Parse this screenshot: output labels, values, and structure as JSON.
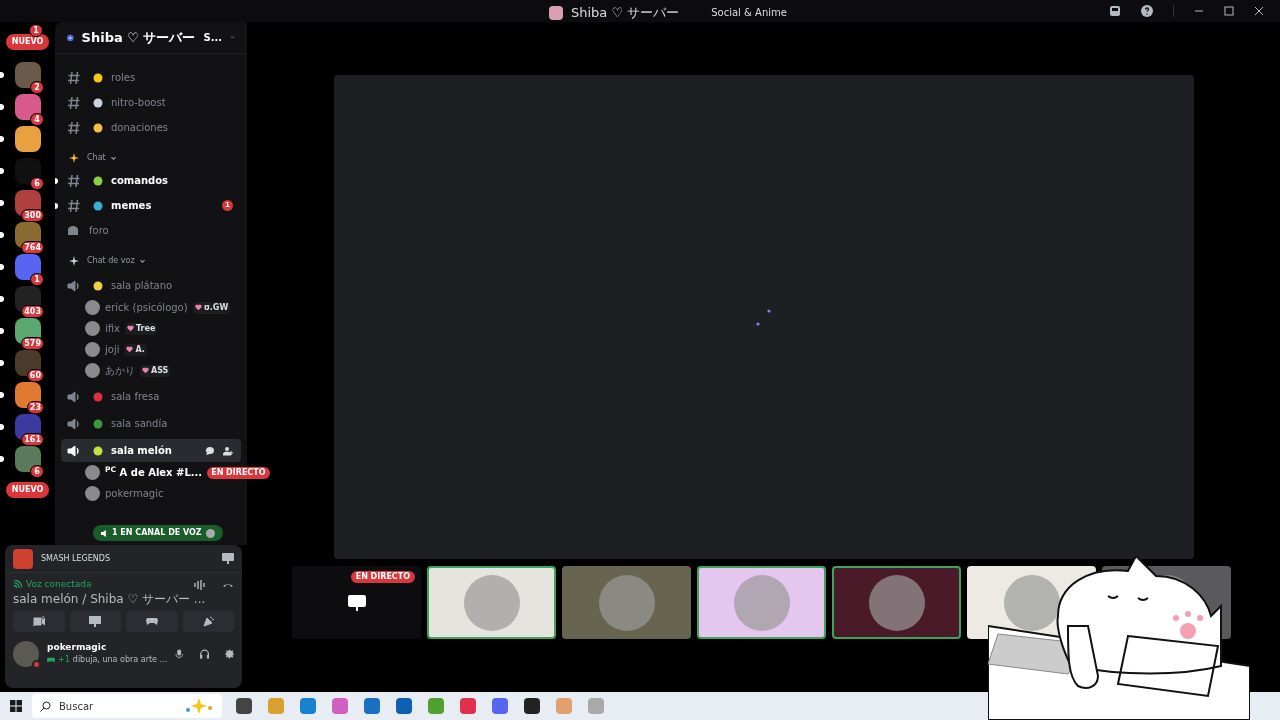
{
  "titlebar": {
    "server": "Shiba ♡ サーバー",
    "category": "Social & Anime"
  },
  "servers": [
    {
      "kind": "pill",
      "label": "NUEVO",
      "badge": "1"
    },
    {
      "kind": "icon",
      "badge": "2",
      "unread": true
    },
    {
      "kind": "icon",
      "badge": "4",
      "unread": true
    },
    {
      "kind": "icon",
      "unread": true
    },
    {
      "kind": "icon",
      "badge": "6",
      "unread": true
    },
    {
      "kind": "icon",
      "badge": "300",
      "unread": true
    },
    {
      "kind": "icon",
      "badge": "764",
      "unread": true
    },
    {
      "kind": "icon",
      "badge": "1",
      "unread": true
    },
    {
      "kind": "icon",
      "badge": "403",
      "unread": true
    },
    {
      "kind": "icon",
      "badge": "579",
      "unread": true
    },
    {
      "kind": "icon",
      "badge": "60",
      "unread": true
    },
    {
      "kind": "icon",
      "badge": "23",
      "unread": true
    },
    {
      "kind": "icon",
      "badge": "161",
      "unread": true
    },
    {
      "kind": "icon",
      "badge": "6",
      "unread": true
    },
    {
      "kind": "pill",
      "label": "NUEVO"
    }
  ],
  "sidebar": {
    "server_name": "Shiba ♡ サーバー",
    "tag": "S...",
    "items": [
      {
        "kind": "text",
        "name": "roles",
        "unread": false,
        "selected": false
      },
      {
        "kind": "text",
        "name": "nitro-boost",
        "unread": false,
        "selected": false
      },
      {
        "kind": "text",
        "name": "donaciones",
        "unread": false,
        "selected": false
      },
      {
        "kind": "category",
        "name": "Chat"
      },
      {
        "kind": "text",
        "name": "comandos",
        "unread": true,
        "selected": false
      },
      {
        "kind": "text",
        "name": "memes",
        "unread": true,
        "badge": "1",
        "selected": false
      },
      {
        "kind": "forum",
        "name": "foro",
        "unread": false,
        "selected": false
      },
      {
        "kind": "category",
        "name": "Chat de voz"
      },
      {
        "kind": "voice",
        "name": "sala plátano",
        "selected": false,
        "members": [
          {
            "name": "erick (psicólogo)",
            "tag": "ʊ.GW"
          },
          {
            "name": "ifix",
            "tag": "Tree"
          },
          {
            "name": "joji",
            "tag": "A."
          },
          {
            "name": "あかり",
            "tag": "ASS"
          }
        ]
      },
      {
        "kind": "voice",
        "name": "sala fresa",
        "selected": false
      },
      {
        "kind": "voice",
        "name": "sala sandía",
        "selected": false
      },
      {
        "kind": "voice",
        "name": "sala melón",
        "selected": true,
        "members": [
          {
            "name": "$^{PC}$ A de Alex #L...",
            "live": "EN DIRECTO"
          },
          {
            "name": "pokermagic"
          }
        ]
      }
    ],
    "voice_popup": "1 EN CANAL DE VOZ"
  },
  "activity": {
    "game": "SMASH LEGENDS"
  },
  "voice": {
    "status": "Voz conectada",
    "location": "sala melón / Shiba ♡ サーバー ..."
  },
  "user": {
    "name": "pokermagic",
    "extra": "+1",
    "status": "dibuja, una obra arte ..."
  },
  "tiles": [
    {
      "kind": "stream",
      "live": "EN DIRECTO",
      "speaking": false,
      "color": "#0d0d0f"
    },
    {
      "kind": "avatar",
      "speaking": true,
      "color": "#e6e4de"
    },
    {
      "kind": "avatar",
      "speaking": false,
      "color": "#67644f"
    },
    {
      "kind": "avatar",
      "speaking": true,
      "color": "#e4c6ef"
    },
    {
      "kind": "avatar",
      "speaking": true,
      "color": "#4a1a28"
    },
    {
      "kind": "avatar",
      "speaking": false,
      "color": "#eceae2"
    },
    {
      "kind": "avatar",
      "speaking": false,
      "color": "#5a5a5c"
    }
  ],
  "taskbar": {
    "search_placeholder": "Buscar"
  }
}
